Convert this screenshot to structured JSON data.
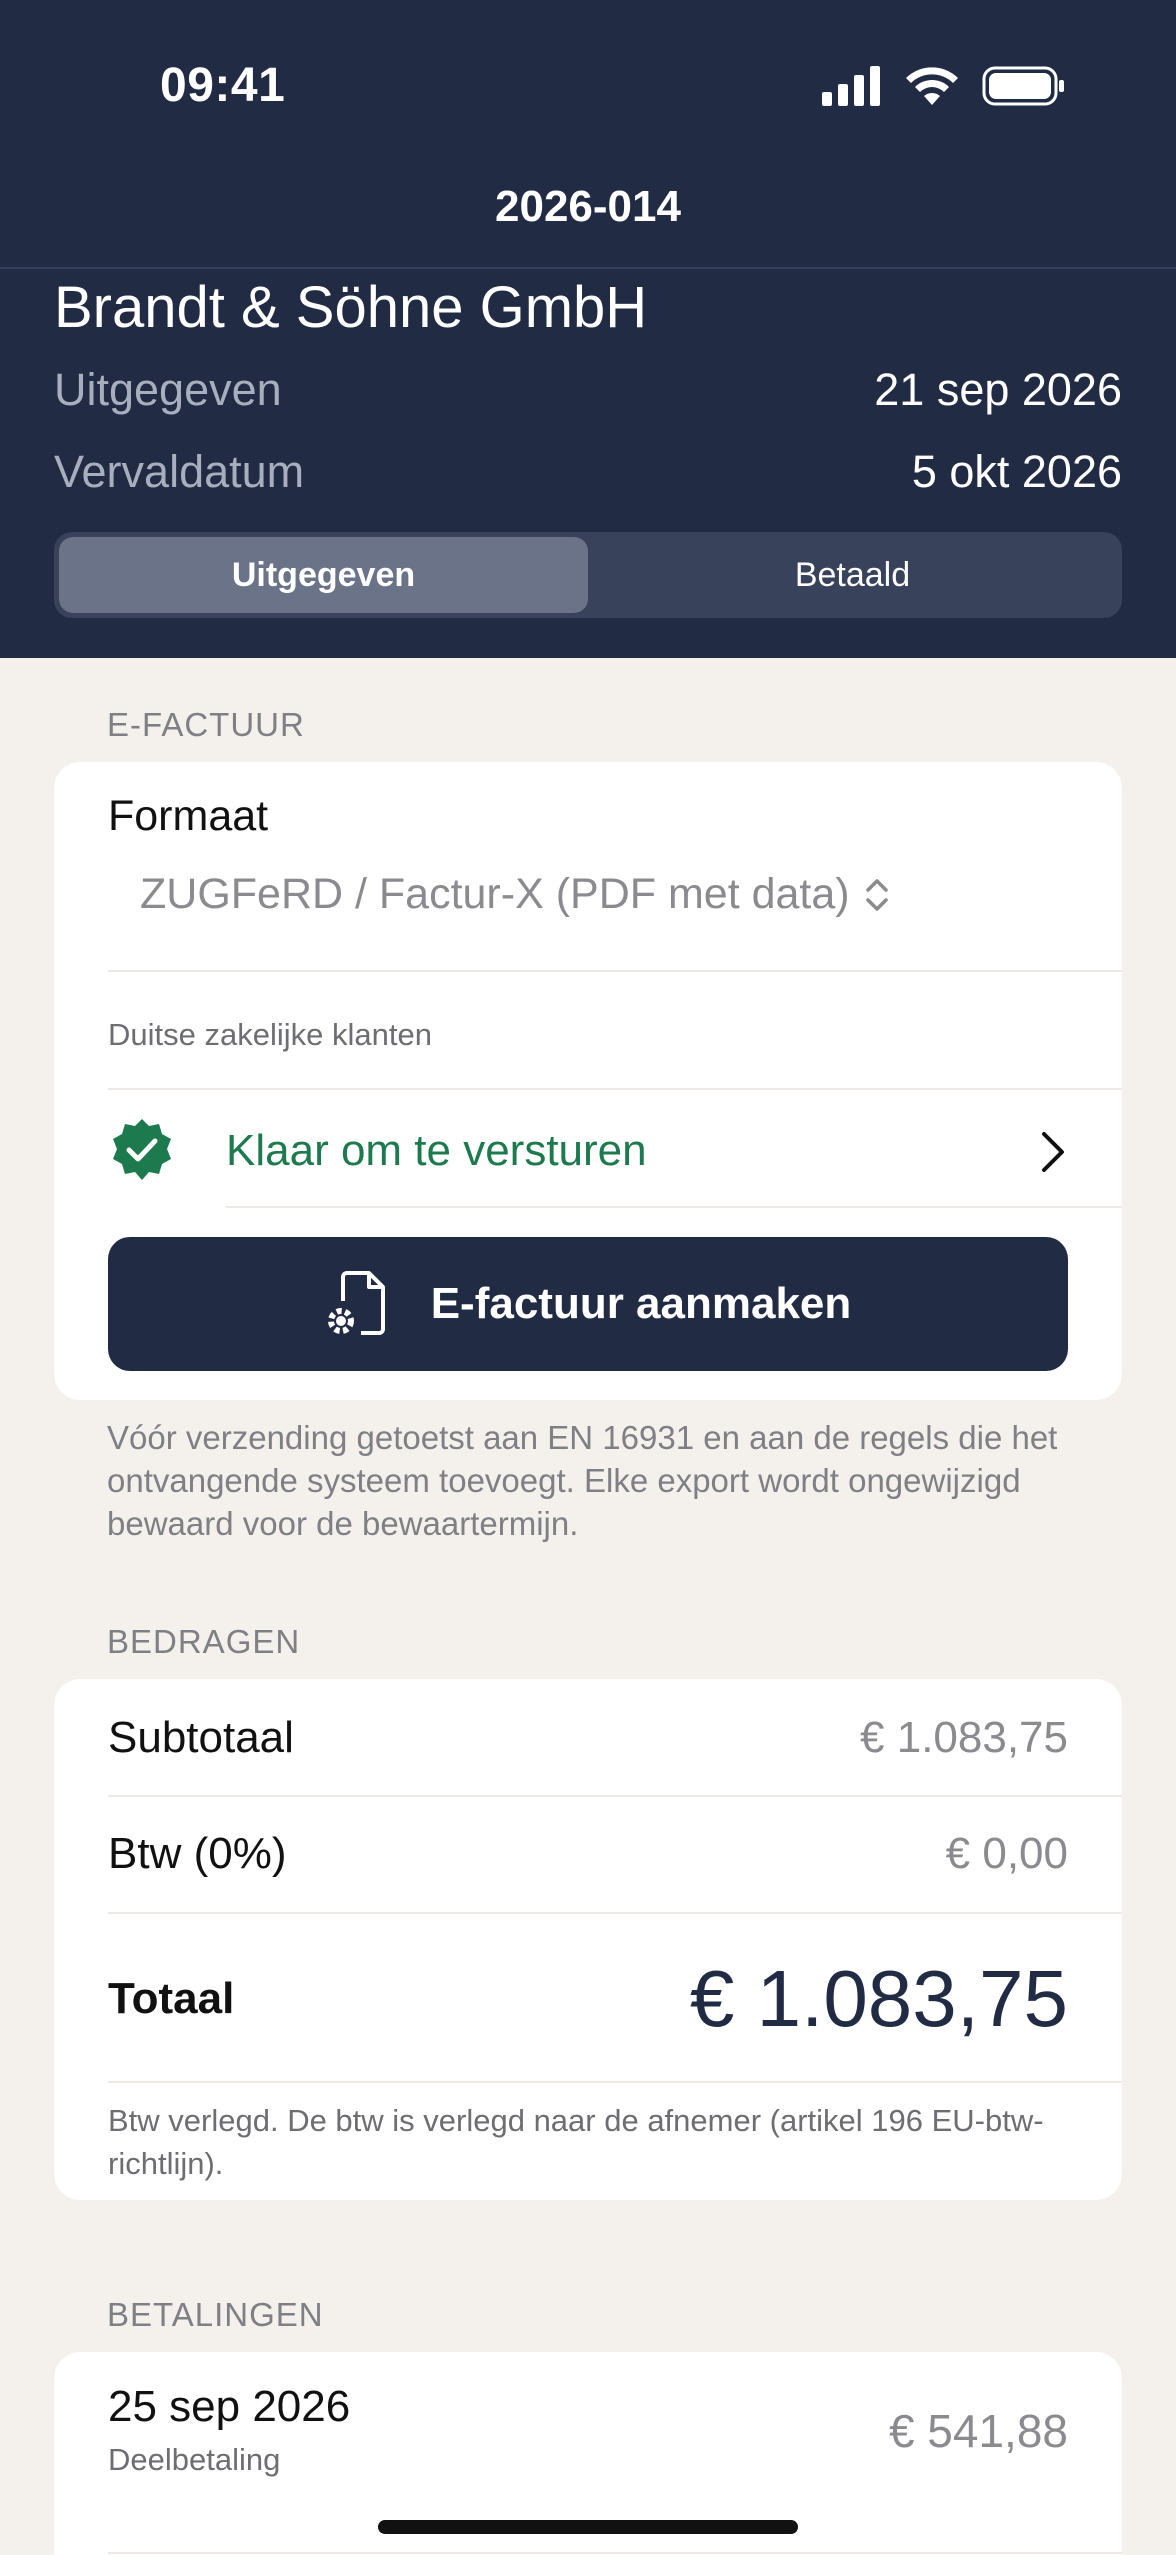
{
  "status_bar": {
    "time": "09:41"
  },
  "nav": {
    "title": "2026-014"
  },
  "header": {
    "client": "Brandt & Söhne GmbH",
    "issued_label": "Uitgegeven",
    "issued_value": "21 sep 2026",
    "due_label": "Vervaldatum",
    "due_value": "5 okt 2026",
    "segments": [
      {
        "label": "Uitgegeven",
        "active": true
      },
      {
        "label": "Betaald",
        "active": false
      }
    ]
  },
  "efactuur": {
    "section_label": "E-FACTUUR",
    "format_label": "Formaat",
    "format_value": "ZUGFeRD / Factur-X (PDF met data)",
    "audience_note": "Duitse zakelijke klanten",
    "status_text": "Klaar om te versturen",
    "button_label": "E-factuur aanmaken",
    "footnote": "Vóór verzending getoetst aan EN 16931 en aan de regels die het ontvangende systeem toevoegt. Elke export wordt ongewijzigd bewaard voor de bewaartermijn."
  },
  "amounts": {
    "section_label": "BEDRAGEN",
    "subtotal_label": "Subtotaal",
    "subtotal_value": "€ 1.083,75",
    "vat_label": "Btw (0%)",
    "vat_value": "€ 0,00",
    "total_label": "Totaal",
    "total_value": "€ 1.083,75",
    "vat_note": "Btw verlegd. De btw is verlegd naar de afnemer (artikel 196 EU-btw-richtlijn)."
  },
  "payments": {
    "section_label": "BETALINGEN",
    "items": [
      {
        "date": "25 sep 2026",
        "type": "Deelbetaling",
        "amount": "€ 541,88"
      }
    ]
  },
  "colors": {
    "header_bg": "#212b44",
    "page_bg": "#f4f0eb",
    "success": "#1d7a4e"
  }
}
